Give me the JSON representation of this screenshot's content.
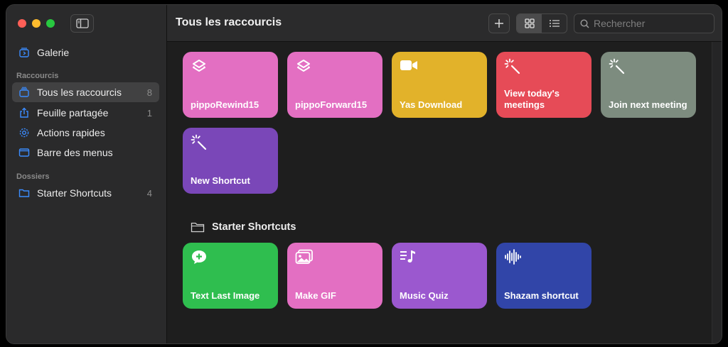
{
  "sidebar": {
    "gallery": "Galerie",
    "section_shortcuts": "Raccourcis",
    "items": [
      {
        "label": "Tous les raccourcis",
        "count": "8"
      },
      {
        "label": "Feuille partagée",
        "count": "1"
      },
      {
        "label": "Actions rapides",
        "count": ""
      },
      {
        "label": "Barre des menus",
        "count": ""
      }
    ],
    "section_folders": "Dossiers",
    "folders": [
      {
        "label": "Starter Shortcuts",
        "count": "4"
      }
    ]
  },
  "toolbar": {
    "title": "Tous les raccourcis",
    "search_placeholder": "Rechercher"
  },
  "shortcuts": [
    {
      "title": "pippoRewind15",
      "icon": "layers-icon",
      "color": "#e36fc2"
    },
    {
      "title": "pippoForward15",
      "icon": "layers-icon",
      "color": "#e36fc2"
    },
    {
      "title": "Yas Download",
      "icon": "video-camera-icon",
      "color": "#e2b22a"
    },
    {
      "title": "View today's meetings",
      "icon": "magic-wand-icon",
      "color": "#e64b57"
    },
    {
      "title": "Join next meeting",
      "icon": "magic-wand-icon",
      "color": "#7d8c7f"
    },
    {
      "title": "New Shortcut",
      "icon": "magic-wand-icon",
      "color": "#7a47b8"
    }
  ],
  "folder_section": {
    "title": "Starter Shortcuts",
    "shortcuts": [
      {
        "title": "Text Last Image",
        "icon": "speech-plus-icon",
        "color": "#2fbe4f"
      },
      {
        "title": "Make GIF",
        "icon": "photos-icon",
        "color": "#e36fc2"
      },
      {
        "title": "Music Quiz",
        "icon": "music-list-icon",
        "color": "#9b58cf"
      },
      {
        "title": "Shazam shortcut",
        "icon": "waveform-icon",
        "color": "#3145a8"
      }
    ]
  }
}
